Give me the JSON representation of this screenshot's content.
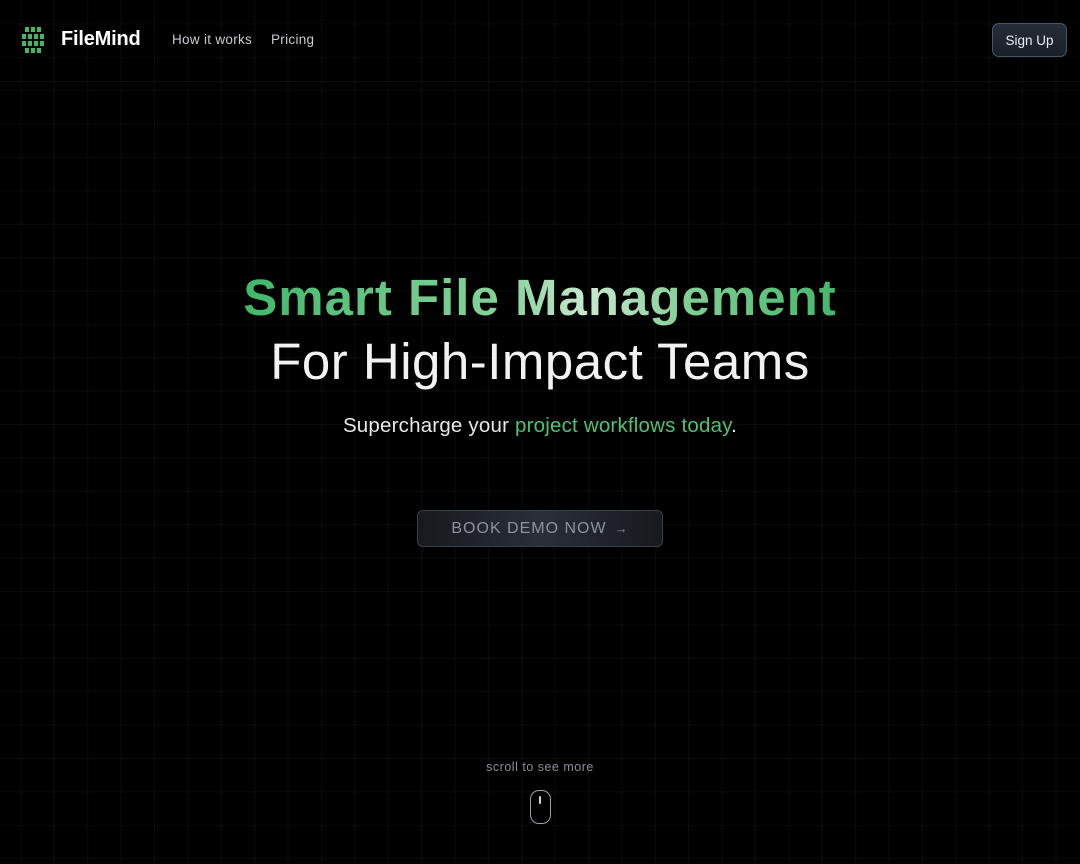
{
  "header": {
    "brand": "FileMind",
    "logo_icon": "grid-logo-icon",
    "nav": [
      {
        "label": "How it works"
      },
      {
        "label": "Pricing"
      }
    ],
    "signup_label": "Sign Up"
  },
  "hero": {
    "title_line1": "Smart File Management",
    "title_line2": "For High-Impact Teams",
    "subtitle_prefix": "Supercharge your ",
    "subtitle_accent": "project workflows today",
    "subtitle_suffix": ".",
    "cta_label": "BOOK DEMO NOW",
    "cta_icon": "arrow-right-icon"
  },
  "scroll": {
    "hint": "scroll to see more",
    "icon": "mouse-icon"
  },
  "colors": {
    "background": "#000000",
    "accent_green": "#4fc172",
    "grid_line": "#141414"
  }
}
